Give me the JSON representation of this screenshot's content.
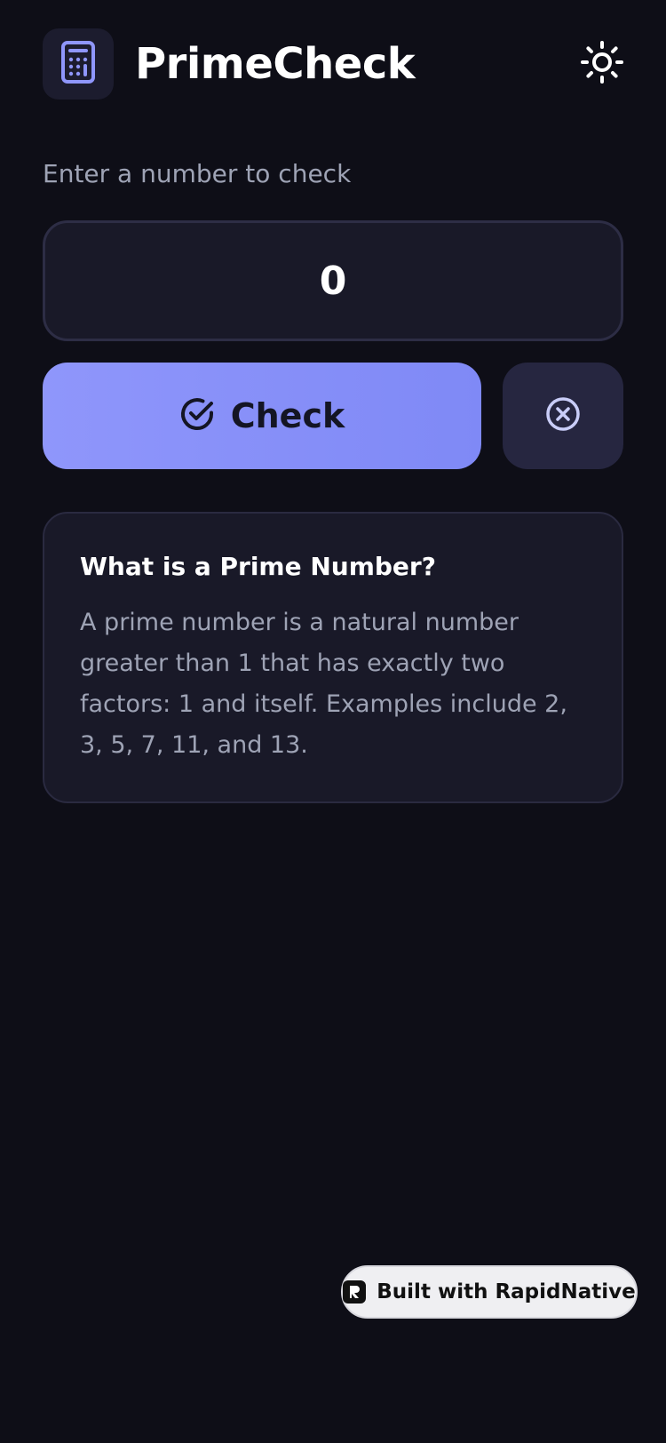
{
  "header": {
    "app_icon": "calculator-icon",
    "title": "PrimeCheck",
    "theme_icon": "sun-icon"
  },
  "prompt": {
    "label": "Enter a number to check"
  },
  "input": {
    "value": "0",
    "placeholder": ""
  },
  "actions": {
    "check_label": "Check",
    "check_icon": "check-circle-icon",
    "clear_icon": "x-circle-icon"
  },
  "info": {
    "title": "What is a Prime Number?",
    "body": "A prime number is a natural number greater than 1 that has exactly two factors: 1 and itself. Examples include 2, 3, 5, 7, 11, and 13."
  },
  "badge": {
    "label": "Built with RapidNative",
    "icon": "rapidnative-logo-icon"
  },
  "colors": {
    "background": "#0e0e17",
    "card": "#191928",
    "accent": "#8f96fb",
    "muted_text": "#9ea3b5"
  }
}
